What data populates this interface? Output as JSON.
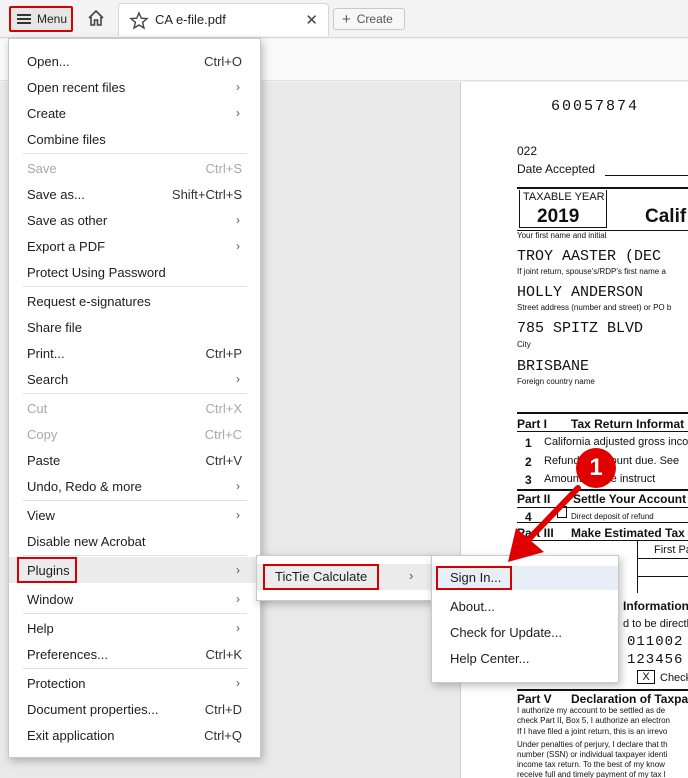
{
  "topbar": {
    "menu_label": "Menu",
    "tab_title": "CA e-file.pdf",
    "create_label": "Create"
  },
  "menu": {
    "items": [
      {
        "label": "Open...",
        "shortcut": "Ctrl+O"
      },
      {
        "label": "Open recent files",
        "arrow": "›"
      },
      {
        "label": "Create",
        "arrow": "›"
      },
      {
        "label": "Combine files"
      },
      {
        "label": "Save",
        "shortcut": "Ctrl+S",
        "disabled": true
      },
      {
        "label": "Save as...",
        "shortcut": "Shift+Ctrl+S"
      },
      {
        "label": "Save as other",
        "arrow": "›"
      },
      {
        "label": "Export a PDF",
        "arrow": "›"
      },
      {
        "label": "Protect Using Password"
      },
      {
        "label": "Request e-signatures"
      },
      {
        "label": "Share file"
      },
      {
        "label": "Print...",
        "shortcut": "Ctrl+P"
      },
      {
        "label": "Search",
        "arrow": "›"
      },
      {
        "label": "Cut",
        "shortcut": "Ctrl+X",
        "disabled": true
      },
      {
        "label": "Copy",
        "shortcut": "Ctrl+C",
        "disabled": true
      },
      {
        "label": "Paste",
        "shortcut": "Ctrl+V"
      },
      {
        "label": "Undo, Redo & more",
        "arrow": "›"
      },
      {
        "label": "View",
        "arrow": "›"
      },
      {
        "label": "Disable new Acrobat"
      },
      {
        "label": "Plugins",
        "arrow": "›"
      },
      {
        "label": "Window",
        "arrow": "›"
      },
      {
        "label": "Help",
        "arrow": "›"
      },
      {
        "label": "Preferences...",
        "shortcut": "Ctrl+K"
      },
      {
        "label": "Protection",
        "arrow": "›"
      },
      {
        "label": "Document properties...",
        "shortcut": "Ctrl+D"
      },
      {
        "label": "Exit application",
        "shortcut": "Ctrl+Q"
      }
    ]
  },
  "plugins_submenu": {
    "item": "TicTie Calculate",
    "arrow": "›"
  },
  "tictie_submenu": {
    "items": [
      "Sign In...",
      "About...",
      "Check for Update...",
      "Help Center..."
    ]
  },
  "annotation": {
    "step": "1"
  },
  "document": {
    "number": "60057874",
    "code": "022",
    "date_accepted": "Date Accepted",
    "taxable_year_label": "TAXABLE YEAR",
    "year": "2019",
    "form_title": "Calif",
    "first_name_label": "Your first name and initial",
    "first_name": "TROY AASTER (DEC",
    "spouse_label": "If joint return, spouse's/RDP's first name a",
    "spouse_name": "HOLLY ANDERSON",
    "street_label": "Street address (number and street) or PO b",
    "street": "785 SPITZ BLVD",
    "city_label": "City",
    "city": "BRISBANE",
    "country_label": "Foreign country name",
    "part1": "Part I",
    "part1_title": "Tax Return Informat",
    "line1": "California adjusted gross inco",
    "line2": "Refund or amount due. See",
    "line3": "Amount ... See instruct",
    "part2": "Part II",
    "part2_title": "Settle Your Account",
    "line4": "Direct deposit of refund",
    "part3": "Part III",
    "part3_title": "Make Estimated Tax",
    "first_pa": "First Pa",
    "information": "Information",
    "directly": "d to be directly",
    "routing": "011002",
    "account": "123456",
    "check_x": "X",
    "check_label": "Check",
    "part5": "Part V",
    "part5_title": "Declaration of Taxpa",
    "fine1": "I authorize my account to be settled as de",
    "fine2": "check Part II, Box 5, I authorize an electron",
    "fine3": "If I have filed a joint return, this is an irrevo",
    "fine4": "Under penalties of perjury, I declare that th",
    "fine5": "number (SSN) or individual taxpayer identi",
    "fine6": "income tax return. To the best of my know",
    "fine7": "receive full and timely payment of my tax l"
  }
}
